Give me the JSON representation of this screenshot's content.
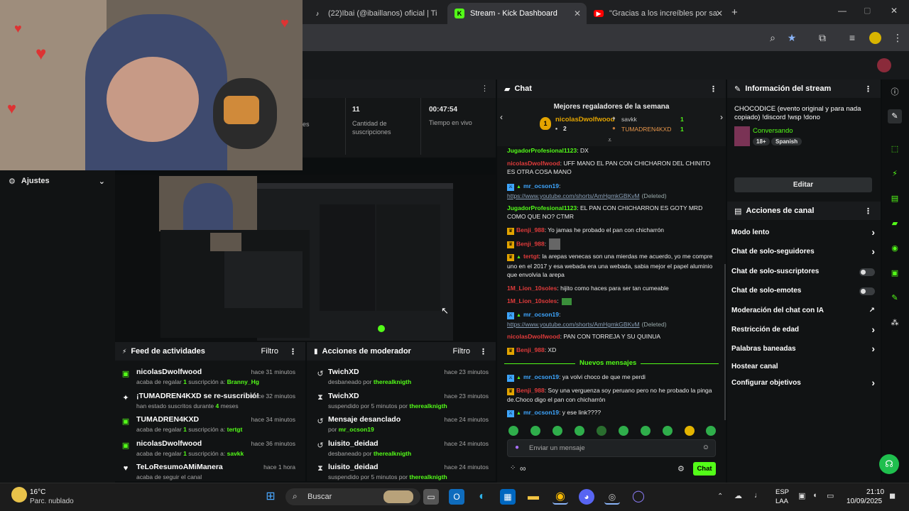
{
  "browser": {
    "tabs": [
      {
        "label": "(22)Ibai (@ibaillanos) oficial | Ti",
        "icon": "tiktok-icon",
        "active": false
      },
      {
        "label": "Stream - Kick Dashboard",
        "icon": "kick-icon",
        "active": true
      },
      {
        "label": "\"Gracias a los increíbles por sa",
        "icon": "youtube-icon",
        "active": false
      }
    ]
  },
  "webcam": {
    "label": "webcam-overlay"
  },
  "stats": [
    {
      "value": "11",
      "label": "Cantidad de suscripciones"
    },
    {
      "value": "00:47:54",
      "label": "Tiempo en vivo"
    }
  ],
  "stats_partial": "es",
  "settings": {
    "label": "Ajustes"
  },
  "activity_feed": {
    "title": "Feed de actividades",
    "filter": "Filtro",
    "items": [
      {
        "name": "nicolasDwolfwood",
        "pre": "acaba de regalar ",
        "num": "1",
        "mid": " suscripción a: ",
        "target": "Branny_Hg",
        "post": "",
        "time": "hace 31 minutos",
        "icon": "gift-icon"
      },
      {
        "name": "¡TUMADREN4KXD se re-suscribió!",
        "pre": "han estado suscritos durante ",
        "num": "4",
        "mid": " meses",
        "target": "",
        "post": "",
        "time": "hace 32 minutos",
        "icon": "star-icon"
      },
      {
        "name": "TUMADREN4KXD",
        "pre": "acaba de regalar ",
        "num": "1",
        "mid": " suscripción a: ",
        "target": "tertgt",
        "post": "",
        "time": "hace 34 minutos",
        "icon": "gift-icon"
      },
      {
        "name": "nicolasDwolfwood",
        "pre": "acaba de regalar ",
        "num": "1",
        "mid": " suscripción a: ",
        "target": "savkk",
        "post": "",
        "time": "hace 36 minutos",
        "icon": "gift-icon"
      },
      {
        "name": "TeLoResumoAMiManera",
        "pre": "acaba de seguir el canal",
        "num": "",
        "mid": "",
        "target": "",
        "post": "",
        "time": "hace 1 hora",
        "icon": "heart-icon"
      }
    ]
  },
  "mod_actions": {
    "title": "Acciones de moderador",
    "filter": "Filtro",
    "items": [
      {
        "name": "TwichXD",
        "pre": "desbaneado por ",
        "by": "therealknigth",
        "time": "hace 23 minutos",
        "icon": "undo-icon"
      },
      {
        "name": "TwichXD",
        "pre": "suspendido por 5 minutos por ",
        "by": "therealknigth",
        "time": "hace 23 minutos",
        "icon": "hourglass-icon"
      },
      {
        "name": "Mensaje desanclado",
        "pre": "por ",
        "by": "mr_ocson19",
        "time": "hace 24 minutos",
        "icon": "undo-icon"
      },
      {
        "name": "luisito_deidad",
        "pre": "desbaneado por ",
        "by": "therealknigth",
        "time": "hace 24 minutos",
        "icon": "undo-icon"
      },
      {
        "name": "luisito_deidad",
        "pre": "suspendido por 5 minutos por ",
        "by": "therealknigth",
        "time": "hace 24 minutos",
        "icon": "hourglass-icon"
      }
    ]
  },
  "chat": {
    "title": "Chat",
    "top_gifters_title": "Mejores regaladores de la semana",
    "gifters": [
      {
        "rank": "1",
        "name": "nicolasDwolfwood",
        "count": "2"
      },
      {
        "rank": "",
        "name": "savkk",
        "count": "1"
      },
      {
        "rank": "",
        "name": "TUMADREN4KXD",
        "count": "1"
      }
    ],
    "new_messages": "Nuevos mensajes",
    "input_placeholder": "Enviar un mensaje",
    "send_label": "Chat",
    "deleted": "(Deleted)",
    "messages": [
      {
        "user": "JugadorProfesional1123",
        "color": "#53fc18",
        "text": ": DX"
      },
      {
        "user": "nicolasDwolfwood",
        "color": "#e13b3b",
        "text": ": UFF MANO EL PAN CON CHICHARON DEL CHINITO ES OTRA COSA MANO"
      },
      {
        "user": "mr_ocson19",
        "color": "#3ea6ff",
        "text": ":",
        "link": "https://www.youtube.com/shorts/AmHgmkGBKvM"
      },
      {
        "user": "JugadorProfesional1123",
        "color": "#53fc18",
        "text": ": EL PAN CON CHICHARRON ES GOTY MRD COMO QUE NO? CTMR"
      },
      {
        "user": "Benji_988",
        "color": "#e13b3b",
        "text": ": Yo jamas he probado el pan con chicharrón"
      },
      {
        "user": "Benji_988",
        "color": "#e13b3b",
        "text": ":"
      },
      {
        "user": "tertgt",
        "color": "#e13b3b",
        "text": ": la arepas venecas son una mierdas me acuerdo, yo me compre uno en el 2017 y esa webada era una webada, sabia mejor el papel aluminio que envolvia la arepa"
      },
      {
        "user": "1M_Lion_10soles",
        "color": "#e13b3b",
        "text": ": hijito como haces para ser tan cumeable"
      },
      {
        "user": "1M_Lion_10soles",
        "color": "#e13b3b",
        "text": ":"
      },
      {
        "user": "mr_ocson19",
        "color": "#3ea6ff",
        "text": ":",
        "link": "https://www.youtube.com/shorts/AmHgmkGBKvM"
      },
      {
        "user": "nicolasDwolfwood",
        "color": "#e13b3b",
        "text": ": PAN CON TORREJA Y SU QUINUA"
      },
      {
        "user": "Benji_988",
        "color": "#e13b3b",
        "text": ": XD"
      },
      {
        "user": "mr_ocson19",
        "color": "#3ea6ff",
        "text": ": ya volvi choco de que me perdi"
      },
      {
        "user": "Benji_988",
        "color": "#e13b3b",
        "text": ": Soy una verguenza soy peruano pero no he probado la pinga de.Choco digo el pan con chicharrón"
      },
      {
        "user": "mr_ocson19",
        "color": "#3ea6ff",
        "text": ": y ese link????"
      }
    ]
  },
  "stream_info": {
    "title": "Información del stream",
    "stream_title": "CHOCODICE (evento original y para nada copiado) !discord !wsp !dono",
    "category": "Conversando",
    "tags": [
      "18+",
      "Spanish"
    ],
    "edit_label": "Editar"
  },
  "channel_actions": {
    "title": "Acciones de canal",
    "items": [
      {
        "label": "Modo lento",
        "control": "chevron"
      },
      {
        "label": "Chat de solo-seguidores",
        "control": "chevron"
      },
      {
        "label": "Chat de solo-suscriptores",
        "control": "toggle"
      },
      {
        "label": "Chat de solo-emotes",
        "control": "toggle"
      },
      {
        "label": "Moderación del chat con IA",
        "control": "external"
      },
      {
        "label": "Restricción de edad",
        "control": "chevron"
      },
      {
        "label": "Palabras baneadas",
        "control": "chevron"
      },
      {
        "label": "Hostear canal",
        "control": "none"
      },
      {
        "label": "Configurar objetivos",
        "control": "chevron"
      }
    ]
  },
  "taskbar": {
    "weather_temp": "16°C",
    "weather_desc": "Parc. nublado",
    "search_placeholder": "Buscar",
    "lang": "ESP",
    "lang2": "LAA",
    "time": "21:10",
    "date": "10/09/2025"
  },
  "colors": {
    "accent": "#53fc18",
    "danger": "#e13b3b",
    "link": "#3ea6ff"
  }
}
